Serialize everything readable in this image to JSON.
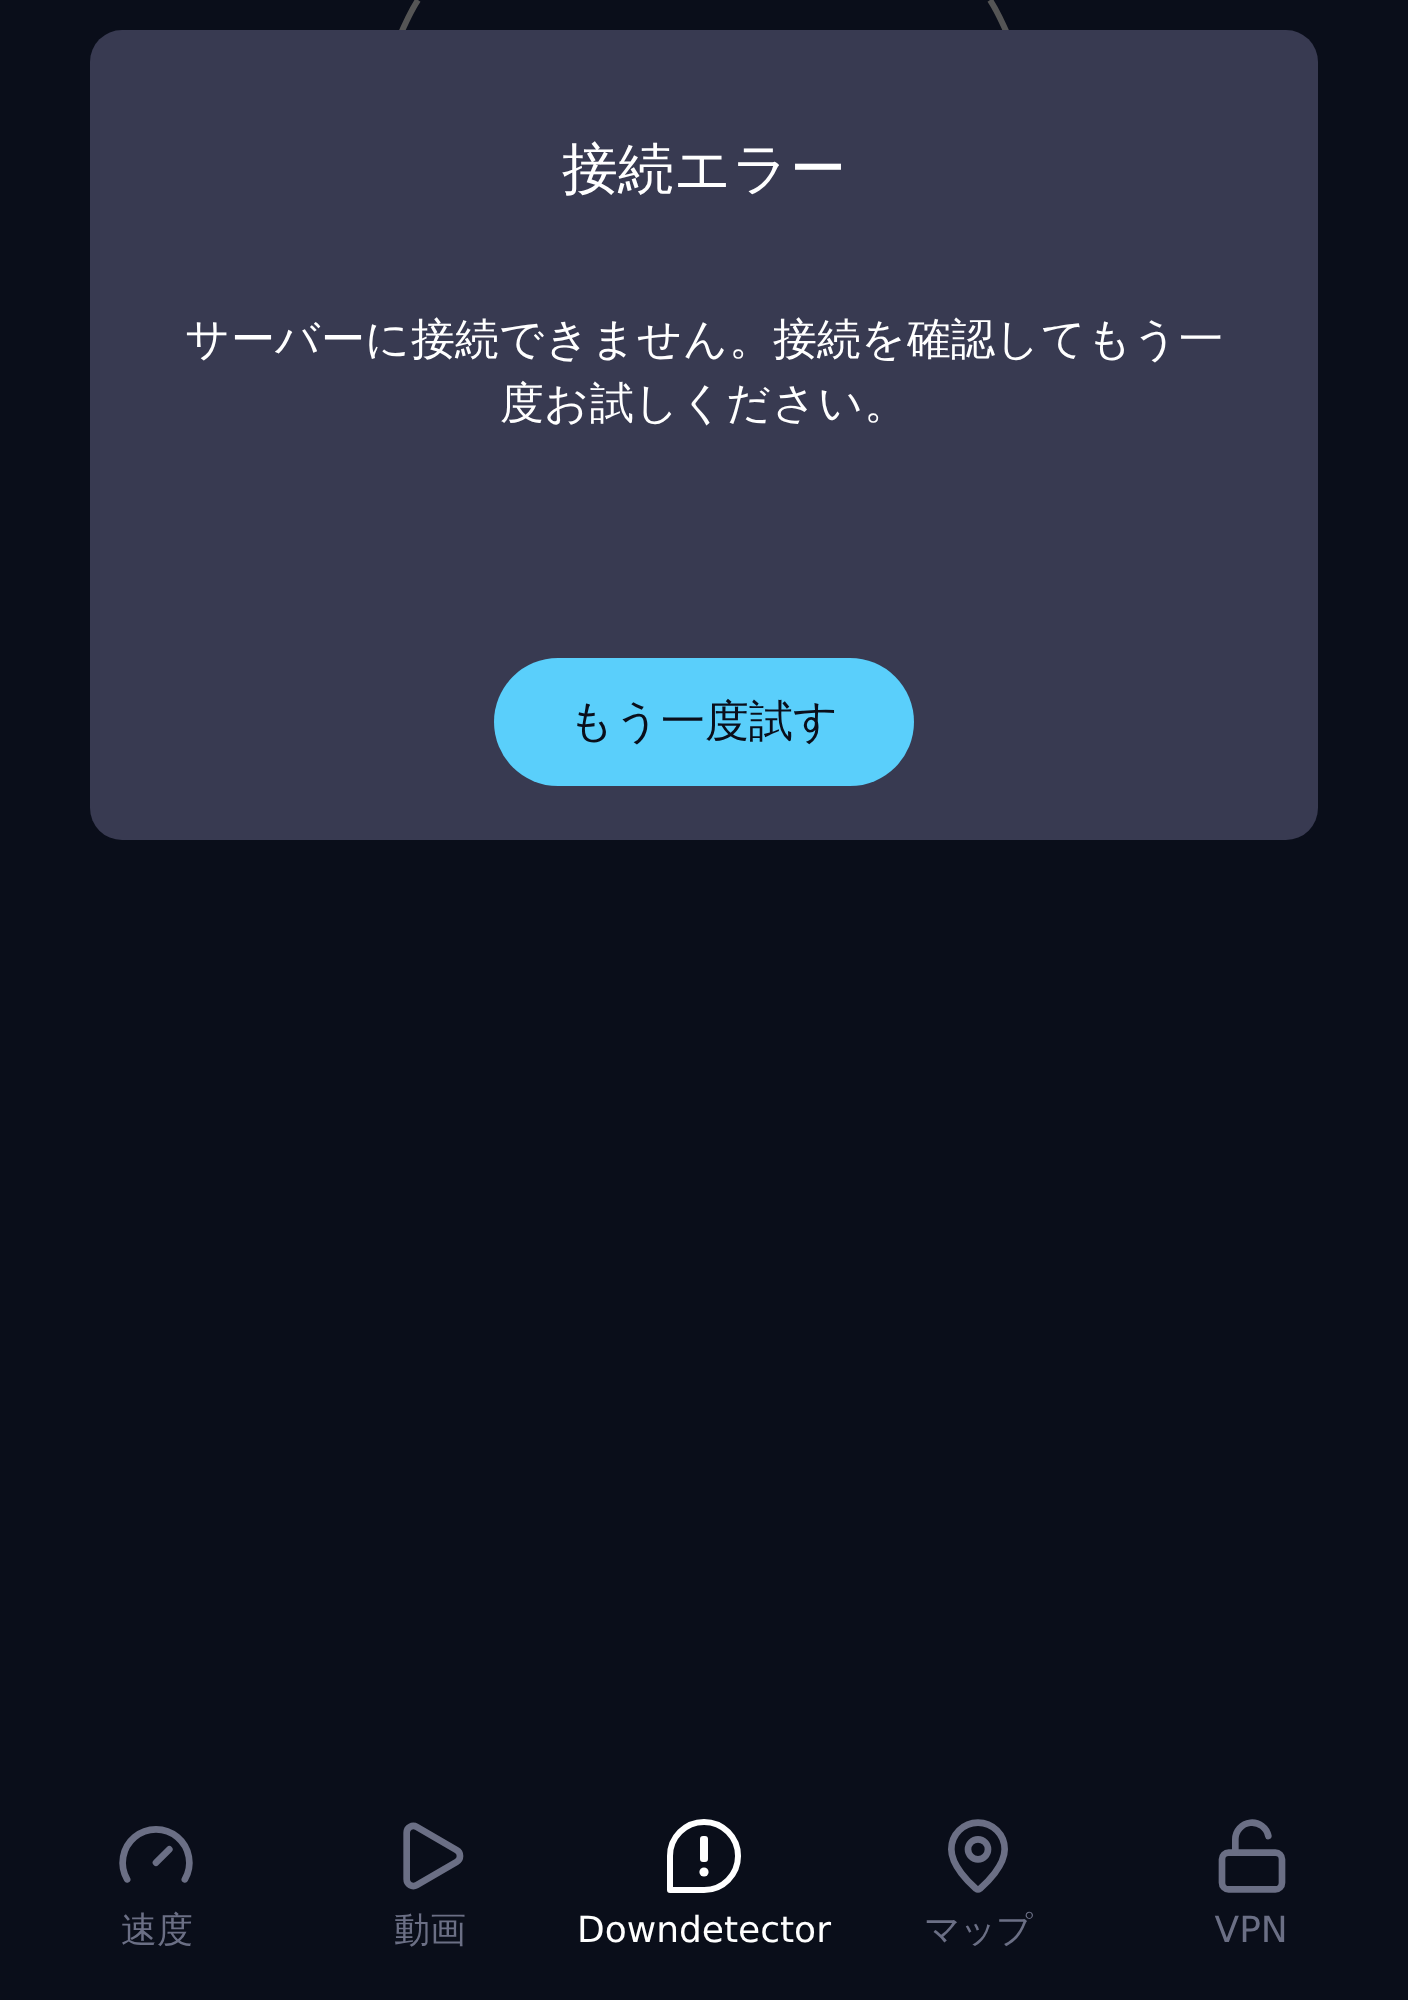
{
  "dialog": {
    "title": "接続エラー",
    "message": "サーバーに接続できません。接続を確認してもう一度お試しください。",
    "button": "もう一度試す"
  },
  "nav": [
    {
      "kind": "speed",
      "label": "速度",
      "selected": false
    },
    {
      "kind": "video",
      "label": "動画",
      "selected": false
    },
    {
      "kind": "alert",
      "label": "Downdetector",
      "selected": true
    },
    {
      "kind": "map",
      "label": "マップ",
      "selected": false
    },
    {
      "kind": "vpn",
      "label": "VPN",
      "selected": false
    }
  ]
}
